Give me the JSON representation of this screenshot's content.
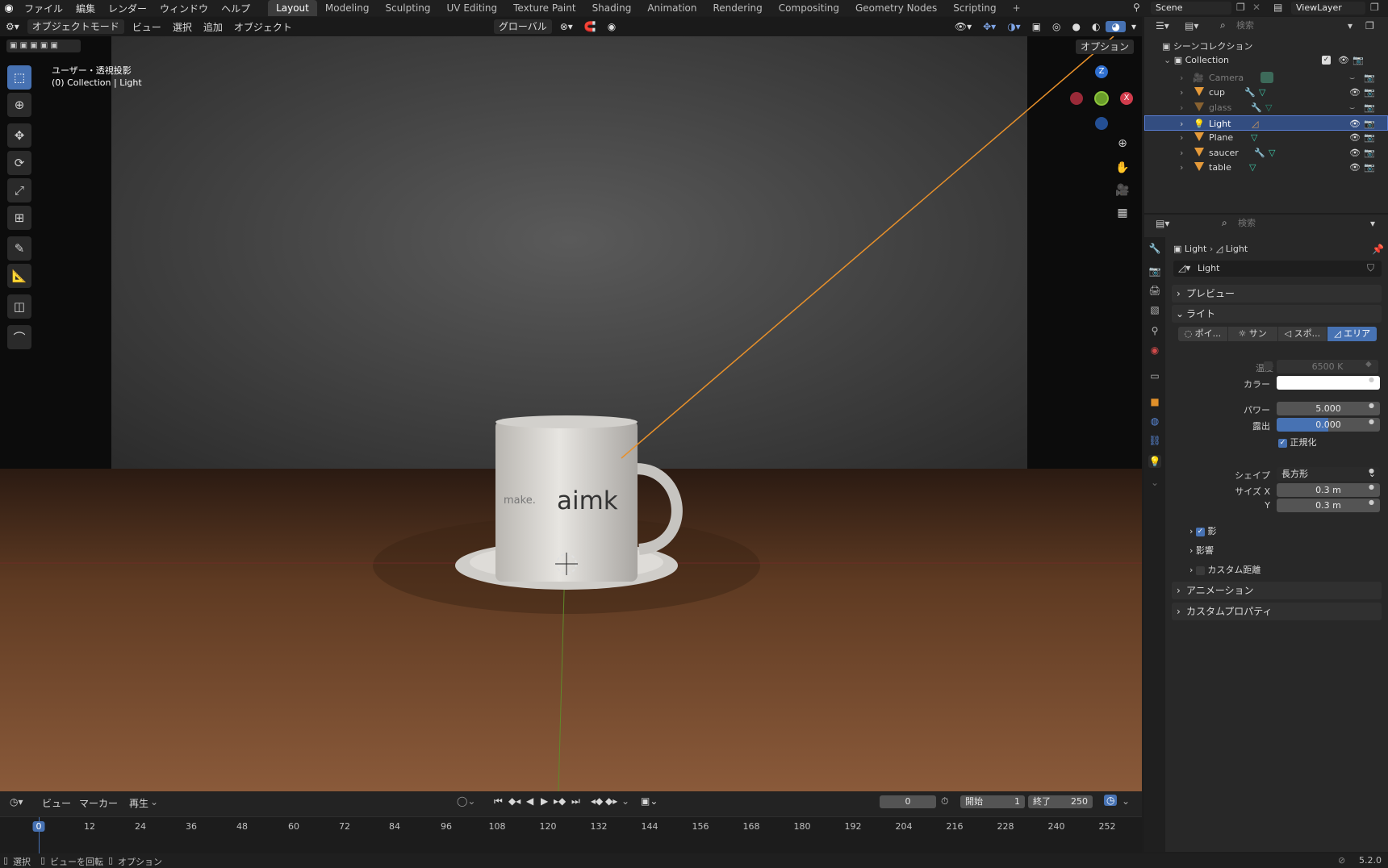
{
  "menu": {
    "file": "ファイル",
    "edit": "編集",
    "render": "レンダー",
    "window": "ウィンドウ",
    "help": "ヘルプ"
  },
  "workspaces": [
    "Layout",
    "Modeling",
    "Sculpting",
    "UV Editing",
    "Texture Paint",
    "Shading",
    "Animation",
    "Rendering",
    "Compositing",
    "Geometry Nodes",
    "Scripting"
  ],
  "scene": {
    "scene_name": "Scene",
    "view_layer": "ViewLayer"
  },
  "viewport": {
    "mode": "オブジェクトモード",
    "view": "ビュー",
    "select": "選択",
    "add": "追加",
    "object": "オブジェクト",
    "transform_orientation": "グローバル",
    "options": "オプション",
    "overlay_title": "ユーザー・透視投影",
    "overlay_context_prefix": "(0) Collection |",
    "overlay_context_obj": "Light",
    "mug_text_a": "make.",
    "mug_text_b": "aimk",
    "gizmo_z": "Z",
    "gizmo_x": "X"
  },
  "outliner": {
    "search_placeholder": "検索",
    "root": "シーンコレクション",
    "collection": "Collection",
    "items": [
      {
        "name": "Camera",
        "dim": true
      },
      {
        "name": "cup",
        "dim": false
      },
      {
        "name": "glass",
        "dim": true
      },
      {
        "name": "Light",
        "dim": false,
        "selected": true
      },
      {
        "name": "Plane",
        "dim": false
      },
      {
        "name": "saucer",
        "dim": false
      },
      {
        "name": "table",
        "dim": false
      }
    ]
  },
  "properties": {
    "search_placeholder": "検索",
    "breadcrumb_object": "Light",
    "breadcrumb_data": "Light",
    "datablock": "Light",
    "panel_preview": "プレビュー",
    "panel_light": "ライト",
    "light_types": [
      "ポイ...",
      "サン",
      "スポ...",
      "エリア"
    ],
    "temperature_label": "温度",
    "temperature_value": "6500 K",
    "color_label": "カラー",
    "power_label": "パワー",
    "power_value": "5.000",
    "exposure_label": "露出",
    "exposure_value": "0.000",
    "normalize_label": "正規化",
    "shape_label": "シェイプ",
    "shape_value": "長方形",
    "size_x_label": "サイズ X",
    "size_x_value": "0.3 m",
    "size_y_label": "Y",
    "size_y_value": "0.3 m",
    "sub_shadow": "影",
    "sub_influence": "影響",
    "sub_custom_distance": "カスタム距離",
    "panel_animation": "アニメーション",
    "panel_custom_props": "カスタムプロパティ"
  },
  "timeline": {
    "view": "ビュー",
    "marker": "マーカー",
    "playback": "再生",
    "current_frame": "0",
    "start_label": "開始",
    "start_value": "1",
    "end_label": "終了",
    "end_value": "250",
    "ticks": [
      "0",
      "12",
      "24",
      "36",
      "48",
      "60",
      "72",
      "84",
      "96",
      "108",
      "120",
      "132",
      "144",
      "156",
      "168",
      "180",
      "192",
      "204",
      "216",
      "228",
      "240",
      "252"
    ]
  },
  "status": {
    "select": "選択",
    "rotate_view": "ビューを回転",
    "options": "オプション",
    "version": "5.2.0"
  },
  "colors": {
    "accent": "#4772b3",
    "selected_row": "#334d80",
    "light_ray": "#e8902a"
  }
}
